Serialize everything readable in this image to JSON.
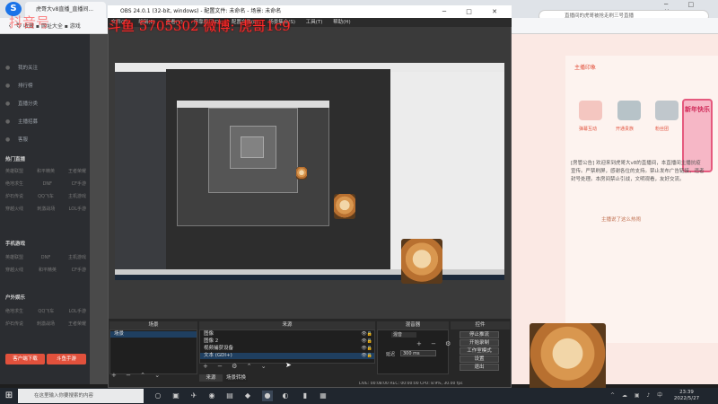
{
  "browser": {
    "tab_title": "虎哥大v8直播_直播间...",
    "bookmarks": "收藏 ▪ 网址大全 ▪ 游戏",
    "search_placeholder": "直播间的虎哥被抢走刷三号直播",
    "logo": "S"
  },
  "overlay": {
    "text_main": "斗鱼 5705302  微博: 虎哥1c9",
    "text_left": "抖音号"
  },
  "obs": {
    "title": "OBS 24.0.1 (32-bit, windows) - 配置文件: 未命名 - 场景: 未命名",
    "menu": [
      "文件(F)",
      "编辑(E)",
      "查看(V)",
      "停靠窗口(D)",
      "配置文件(P)",
      "场景集合(S)",
      "工具(T)",
      "帮助(H)"
    ],
    "docks": {
      "scenes_title": "场景",
      "sources_title": "来源",
      "mixer_title": "混音器",
      "controls_title": "控件",
      "scene_item": "场景",
      "sources": [
        "图像",
        "图像 2",
        "视频捕获设备",
        "文本 (GDI+)"
      ],
      "mixer_label1": "混音",
      "mixer_label2": "延迟",
      "mixer_value": "300 ms",
      "controls": [
        "停止推流",
        "开始录制",
        "工作室模式",
        "设置",
        "退出"
      ],
      "tab_scene": "来源",
      "tab_transition": "场景转换"
    },
    "status": "LIVE: 00:08:00  REC: 00:00:00  CPU: 8.9%, 30.00 fps"
  },
  "sidebar": {
    "items": [
      "我的关注",
      "排行榜",
      "直播分类",
      "主播招募",
      "客服"
    ],
    "section1": "热门直播",
    "grid1": [
      "英雄联盟",
      "和平精英",
      "王者荣耀"
    ],
    "grid2": [
      "绝地求生",
      "DNF",
      "CF手游"
    ],
    "grid3": [
      "炉石传说",
      "QQ飞车",
      "主机游戏"
    ],
    "grid4": [
      "穿越火线",
      "刺激战场",
      "LOL手游"
    ],
    "section2": "手机游戏",
    "section3": "户外娱乐",
    "btn1": "客户端下载",
    "btn2": "斗鱼手游"
  },
  "right_panel": {
    "gift_title": "主播印象",
    "gifts": [
      "弹幕互动",
      "开通贵族",
      "粉丝团"
    ],
    "chat": "[房管公告] 欢迎来到虎哥大v8的直播间，本直播间主播抗疫宣传。严禁刷屏，感谢各位的支持。禁止发布广告链接，违者封号处理。本房间禁止引战，文明观看，友好交流。",
    "promo": "新年快乐",
    "user_msg": "主播说了这么热闹"
  },
  "taskbar": {
    "search": "在这里输入你要搜索的内容",
    "time": "23:39",
    "date": "2022/5/27"
  }
}
